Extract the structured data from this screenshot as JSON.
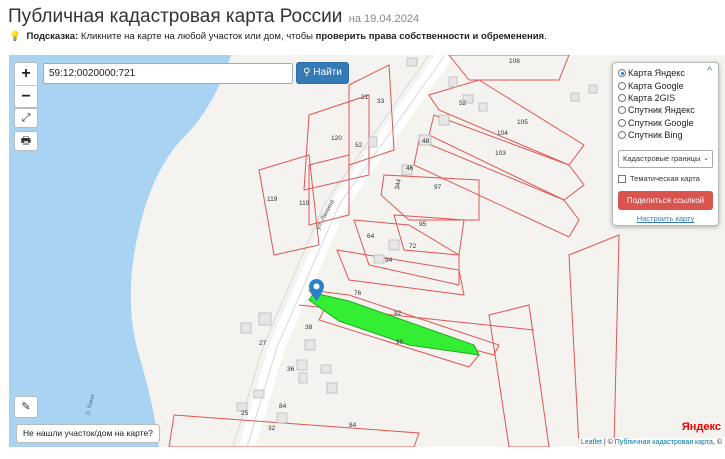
{
  "header": {
    "title": "Публичная кадастровая карта России",
    "date": "на 19.04.2024"
  },
  "hint": {
    "label": "Подсказка:",
    "text": "Кликните на карте на любой участок или дом, чтобы",
    "bold": "проверить права собственности и обременения",
    "end": "."
  },
  "controls": {
    "zoom_in": "+",
    "zoom_out": "−",
    "fullscreen_icon": "⤢",
    "print_icon": "🖶",
    "ruler_icon": "✎"
  },
  "search": {
    "value": "59:12:0020000:721",
    "button": "Найти",
    "icon": "search-icon"
  },
  "layers": {
    "options": [
      "Карта Яндекс",
      "Карта Google",
      "Карта 2GIS",
      "Спутник Яндекс",
      "Спутник Google",
      "Спутник Bing"
    ],
    "selected": "Карта Яндекс",
    "boundaries": "Кадастровые границы",
    "thematic": "Тематическая карта",
    "share": "Поделиться ссылкой",
    "configure": "Настроить карту"
  },
  "map": {
    "street": "ул. Ленина",
    "river": "р. Кама",
    "parcel_numbers": [
      "108",
      "21",
      "33",
      "120",
      "52",
      "119",
      "119",
      "105",
      "104",
      "103",
      "48",
      "46",
      "344",
      "97",
      "95",
      "72",
      "64",
      "94",
      "92",
      "90",
      "38",
      "27",
      "36",
      "25",
      "84",
      "84",
      "32",
      "76",
      "82",
      "50"
    ],
    "highlight_color": "#33ee33",
    "border_color": "#e05555",
    "water_color": "#a9d3f2"
  },
  "bottom": {
    "not_found": "Не нашли участок/дом на карте?",
    "yandex": "Яндекс",
    "leaflet": "Leaflet",
    "separator": " | © ",
    "source": "Публичная кадастровая карта",
    "suffix": ", ©"
  }
}
